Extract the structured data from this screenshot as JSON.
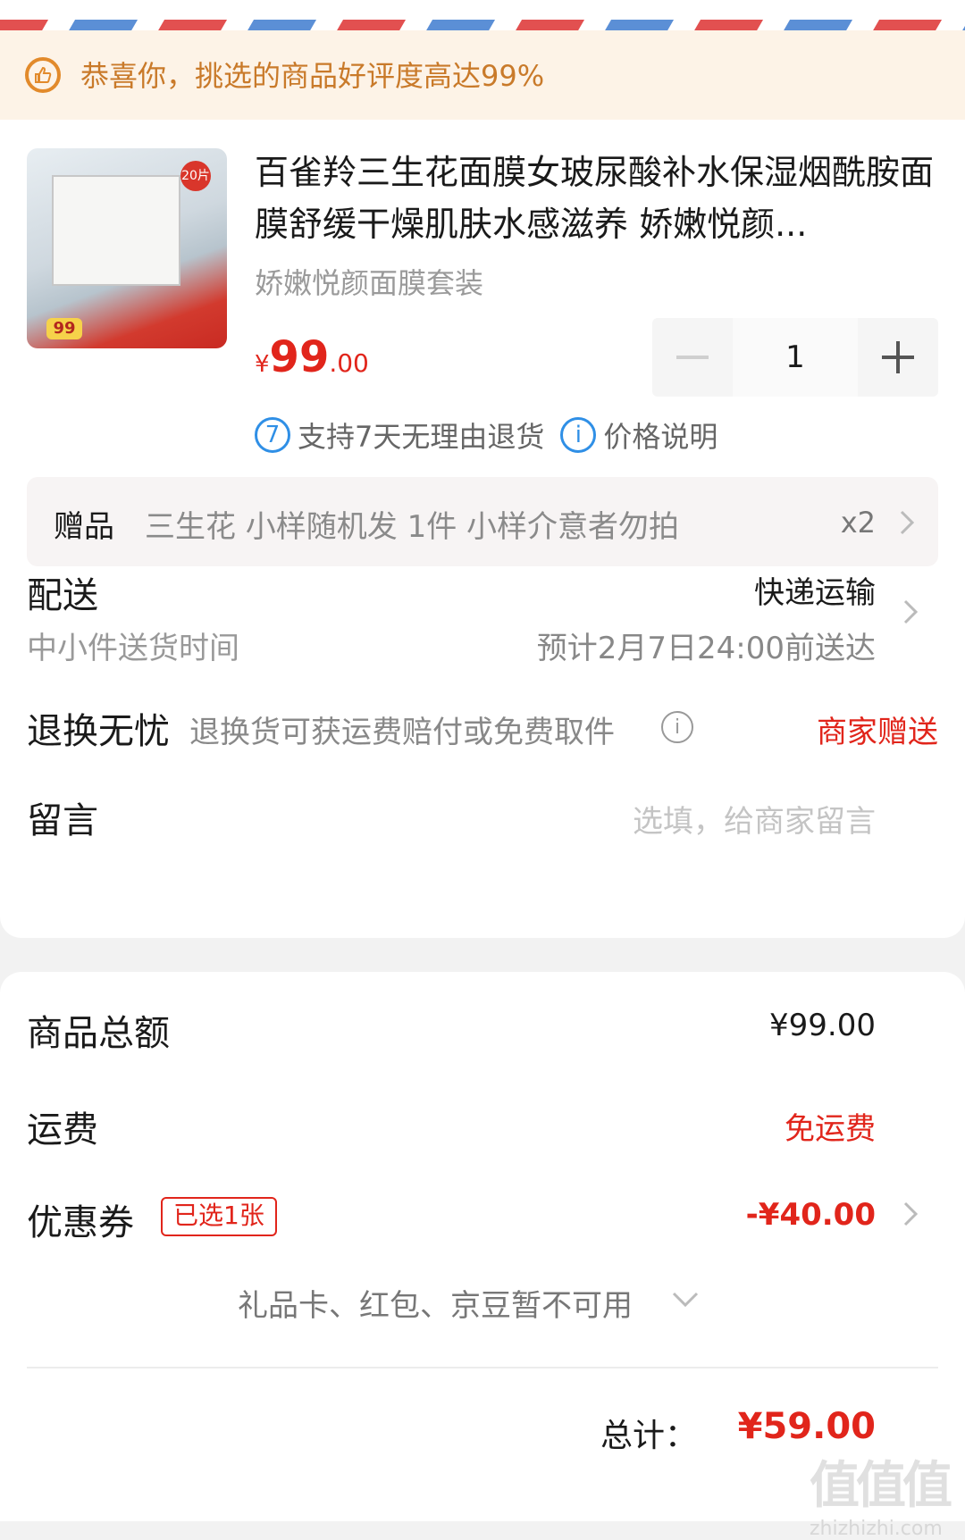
{
  "notice": {
    "text": "恭喜你，挑选的商品好评度高达99%",
    "icon": "thumbs-up-icon"
  },
  "product": {
    "title": "百雀羚三生花面膜女玻尿酸补水保湿烟酰胺面膜舒缓干燥肌肤水感滋养 娇嫩悦颜...",
    "spec": "娇嫩悦颜面膜套装",
    "price_symbol": "¥",
    "price_int": "99",
    "price_dec": ".00",
    "quantity": "1",
    "image_badge": "99",
    "image_corner": "20片"
  },
  "services": {
    "return_policy": "支持7天无理由退货",
    "return_icon_text": "7",
    "price_note": "价格说明",
    "price_icon_text": "i"
  },
  "gift": {
    "label": "赠品",
    "value": "三生花 小样随机发 1件 小样介意者勿拍",
    "count": "x2"
  },
  "delivery": {
    "label": "配送",
    "method": "快递运输",
    "sub_label": "中小件送货时间",
    "eta": "预计2月7日24:00前送达"
  },
  "returns": {
    "label": "退换无忧",
    "desc": "退换货可获运费赔付或免费取件",
    "value": "商家赠送"
  },
  "message": {
    "label": "留言",
    "placeholder": "选填，给商家留言"
  },
  "summary": {
    "goods_total_label": "商品总额",
    "goods_total": "¥99.00",
    "shipping_label": "运费",
    "shipping": "免运费",
    "coupon_label": "优惠券",
    "coupon_tag": "已选1张",
    "coupon_value": "-¥40.00",
    "unavailable": "礼品卡、红包、京豆暂不可用",
    "total_label": "总计：",
    "total": "¥59.00"
  },
  "watermark": {
    "text": "zhizhizhi.com",
    "logo": "值值值"
  },
  "colors": {
    "accent": "#e1251b",
    "notice_bg": "#fdf3e7",
    "notice_text": "#c97a2a",
    "info_blue": "#2f8fe6"
  }
}
